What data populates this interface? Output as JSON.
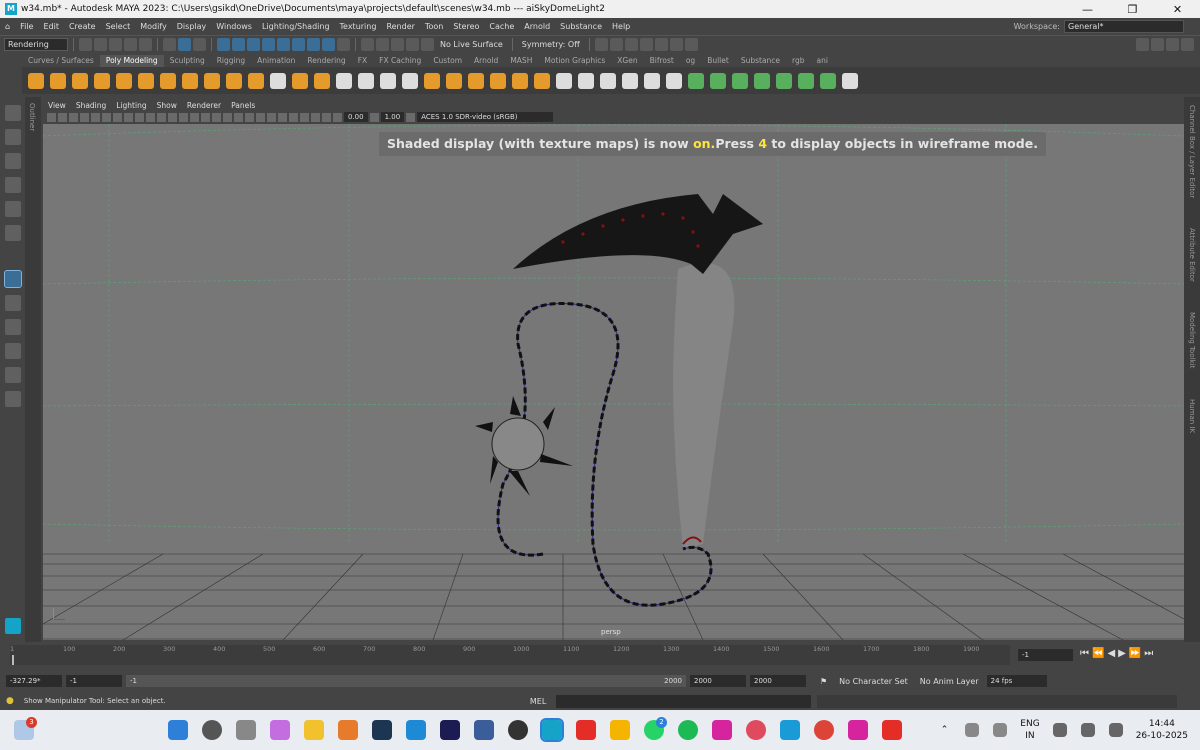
{
  "titlebar": {
    "app_icon": "M",
    "title": "w34.mb* - Autodesk MAYA 2023: C:\\Users\\gsikd\\OneDrive\\Documents\\maya\\projects\\default\\scenes\\w34.mb   ---   aiSkyDomeLight2",
    "minimize": "—",
    "maximize": "❐",
    "close": "✕"
  },
  "menubar": {
    "items": [
      "File",
      "Edit",
      "Create",
      "Select",
      "Modify",
      "Display",
      "Windows",
      "Lighting/Shading",
      "Texturing",
      "Render",
      "Toon",
      "Stereo",
      "Cache",
      "Arnold",
      "Substance",
      "Help"
    ],
    "workspace_label": "Workspace:",
    "workspace_value": "General*"
  },
  "statusline": {
    "mode": "Rendering",
    "live_surface": "No Live Surface",
    "symmetry": "Symmetry: Off"
  },
  "shelf": {
    "tabs": [
      "Curves / Surfaces",
      "Poly Modeling",
      "Sculpting",
      "Rigging",
      "Animation",
      "Rendering",
      "FX",
      "FX Caching",
      "Custom",
      "Arnold",
      "MASH",
      "Motion Graphics",
      "XGen",
      "Bifrost",
      "og",
      "Bullet",
      "Substance",
      "rgb",
      "ani"
    ],
    "active_tab": "Poly Modeling"
  },
  "left_strip": {
    "label": "Outliner"
  },
  "panel": {
    "menus": [
      "View",
      "Shading",
      "Lighting",
      "Show",
      "Renderer",
      "Panels"
    ],
    "field_a": "0.00",
    "field_b": "1.00",
    "colorspace": "ACES 1.0 SDR-video (sRGB)"
  },
  "viewport": {
    "hud_pre": "Shaded display (with texture maps) is now ",
    "hud_on": "on.",
    "hud_mid": "Press ",
    "hud_key": "4",
    "hud_post": " to display objects in wireframe mode.",
    "camera": "persp",
    "colors": {
      "background": "#777777",
      "grid": "#5aa37a",
      "floor_grid": "#333333",
      "blade": "#161616",
      "blade_dots": "#8a1010",
      "chain_curve": "#2a2a9a"
    }
  },
  "right_strip": {
    "labels": [
      "Channel Box / Layer Editor",
      "Attribute Editor",
      "Modeling Toolkit",
      "Human IK"
    ]
  },
  "timeslider": {
    "ticks": [
      "1",
      "100",
      "200",
      "300",
      "400",
      "500",
      "600",
      "700",
      "800",
      "900",
      "1000",
      "1100",
      "1200",
      "1300",
      "1400",
      "1500",
      "1600",
      "1700",
      "1800",
      "1900"
    ],
    "current_frame": "-1"
  },
  "range": {
    "current": "-327.29*",
    "start": "-1",
    "range_start": "-1",
    "range_end": "2000",
    "end_a": "2000",
    "end_b": "2000",
    "character_set": "No Character Set",
    "anim_layer": "No Anim Layer",
    "fps": "24 fps"
  },
  "cmdline": {
    "help": "Show Manipulator Tool: Select an object.",
    "mel": "MEL"
  },
  "taskbar": {
    "weather_badge": "3",
    "whatsapp_badge": "2",
    "lang_top": "ENG",
    "lang_bottom": "IN",
    "time": "14:44",
    "date": "26-10-2025"
  }
}
